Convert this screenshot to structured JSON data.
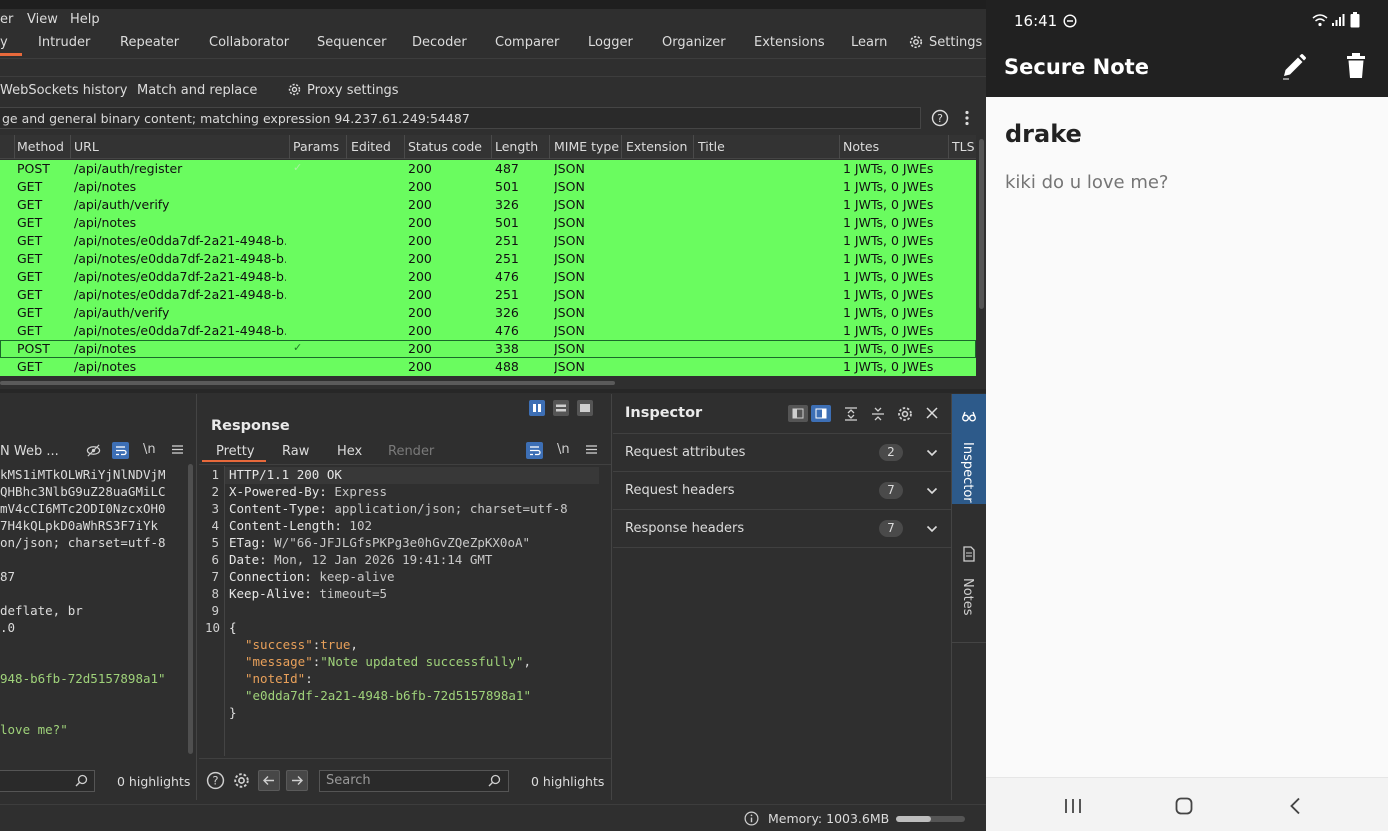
{
  "burp": {
    "menu": [
      "er",
      "View",
      "Help"
    ],
    "tabs": [
      "y",
      "Intruder",
      "Repeater",
      "Collaborator",
      "Sequencer",
      "Decoder",
      "Comparer",
      "Logger",
      "Organizer",
      "Extensions",
      "Learn",
      "Settings"
    ],
    "subtabs": [
      "WebSockets history",
      "Match and replace",
      "Proxy settings"
    ],
    "filter_text": "ge and general binary content; matching expression 94.237.61.249:54487",
    "table": {
      "columns": [
        "Method",
        "URL",
        "Params",
        "Edited",
        "Status code",
        "Length",
        "MIME type",
        "Extension",
        "Title",
        "Notes",
        "TLS"
      ],
      "rows": [
        {
          "method": "POST",
          "url": "/api/auth/register",
          "params": "✓",
          "status": "200",
          "length": "487",
          "mime": "JSON",
          "notes": "1 JWTs, 0 JWEs"
        },
        {
          "method": "GET",
          "url": "/api/notes",
          "params": "",
          "status": "200",
          "length": "501",
          "mime": "JSON",
          "notes": "1 JWTs, 0 JWEs"
        },
        {
          "method": "GET",
          "url": "/api/auth/verify",
          "params": "",
          "status": "200",
          "length": "326",
          "mime": "JSON",
          "notes": "1 JWTs, 0 JWEs"
        },
        {
          "method": "GET",
          "url": "/api/notes",
          "params": "",
          "status": "200",
          "length": "501",
          "mime": "JSON",
          "notes": "1 JWTs, 0 JWEs"
        },
        {
          "method": "GET",
          "url": "/api/notes/e0dda7df-2a21-4948-b...",
          "params": "",
          "status": "200",
          "length": "251",
          "mime": "JSON",
          "notes": "1 JWTs, 0 JWEs"
        },
        {
          "method": "GET",
          "url": "/api/notes/e0dda7df-2a21-4948-b...",
          "params": "",
          "status": "200",
          "length": "251",
          "mime": "JSON",
          "notes": "1 JWTs, 0 JWEs"
        },
        {
          "method": "GET",
          "url": "/api/notes/e0dda7df-2a21-4948-b...",
          "params": "",
          "status": "200",
          "length": "476",
          "mime": "JSON",
          "notes": "1 JWTs, 0 JWEs"
        },
        {
          "method": "GET",
          "url": "/api/notes/e0dda7df-2a21-4948-b...",
          "params": "",
          "status": "200",
          "length": "251",
          "mime": "JSON",
          "notes": "1 JWTs, 0 JWEs"
        },
        {
          "method": "GET",
          "url": "/api/auth/verify",
          "params": "",
          "status": "200",
          "length": "326",
          "mime": "JSON",
          "notes": "1 JWTs, 0 JWEs"
        },
        {
          "method": "GET",
          "url": "/api/notes/e0dda7df-2a21-4948-b...",
          "params": "",
          "status": "200",
          "length": "476",
          "mime": "JSON",
          "notes": "1 JWTs, 0 JWEs"
        },
        {
          "method": "POST",
          "url": "/api/notes",
          "params": "✓",
          "status": "200",
          "length": "338",
          "mime": "JSON",
          "notes": "1 JWTs, 0 JWEs"
        },
        {
          "method": "GET",
          "url": "/api/notes",
          "params": "",
          "status": "200",
          "length": "488",
          "mime": "JSON",
          "notes": "1 JWTs, 0 JWEs"
        }
      ]
    },
    "request": {
      "tab_label": "N Web ...",
      "lines": [
        "kMS1iMTkOLWRiYjNlNDVjM",
        "QHBhc3NlbG9uZ28uaGMiLC",
        "mV4cCI6MTc2ODI0NzcxOH0",
        "7H4kQLpkD0aWhRS3F7iYk",
        "on/json; charset=utf-8",
        "",
        "87",
        "",
        "deflate, br",
        ".0",
        "",
        "",
        "948-b6fb-72d5157898a1\"",
        "",
        "",
        "love me?\""
      ],
      "highlights": "0 highlights"
    },
    "response": {
      "title": "Response",
      "tabs": [
        "Pretty",
        "Raw",
        "Hex",
        "Render"
      ],
      "lines": [
        {
          "n": "1",
          "k": "HTTP/1.1 200 OK",
          "v": ""
        },
        {
          "n": "2",
          "k": "X-Powered-By:",
          "v": " Express"
        },
        {
          "n": "3",
          "k": "Content-Type:",
          "v": " application/json; charset=utf-8"
        },
        {
          "n": "4",
          "k": "Content-Length:",
          "v": " 102"
        },
        {
          "n": "5",
          "k": "ETag:",
          "v": " W/\"66-JFJLGfsPKPg3e0hGvZQeZpKX0oA\""
        },
        {
          "n": "6",
          "k": "Date:",
          "v": " Mon, 12 Jan 2026 19:41:14 GMT"
        },
        {
          "n": "7",
          "k": "Connection:",
          "v": " keep-alive"
        },
        {
          "n": "8",
          "k": "Keep-Alive:",
          "v": " timeout=5"
        },
        {
          "n": "9",
          "k": "",
          "v": ""
        },
        {
          "n": "10",
          "k": "{",
          "v": ""
        }
      ],
      "json": [
        {
          "key": "\"success\"",
          "sep": ":",
          "val": "true",
          "tail": ",",
          "valcolor": "#e8a05a"
        },
        {
          "key": "\"message\"",
          "sep": ":",
          "val": "\"Note updated successfully\"",
          "tail": ",",
          "valcolor": "#9fd27a"
        },
        {
          "key": "\"noteId\"",
          "sep": ":",
          "val": "",
          "tail": "",
          "valcolor": "#9fd27a"
        },
        {
          "key": "",
          "sep": "",
          "val": "\"e0dda7df-2a21-4948-b6fb-72d5157898a1\"",
          "tail": "",
          "valcolor": "#9fd27a"
        }
      ],
      "close": "}",
      "search_placeholder": "Search",
      "highlights": "0 highlights"
    },
    "inspector": {
      "title": "Inspector",
      "sections": [
        {
          "label": "Request attributes",
          "count": "2"
        },
        {
          "label": "Request headers",
          "count": "7"
        },
        {
          "label": "Response headers",
          "count": "7"
        }
      ]
    },
    "side_tabs": [
      "Inspector",
      "Notes"
    ],
    "memory": "Memory: 1003.6MB",
    "memory_fraction": 0.5
  },
  "phone": {
    "time": "16:41",
    "app_title": "Secure Note",
    "note_title": "drake",
    "note_body": "kiki do u love me?"
  }
}
